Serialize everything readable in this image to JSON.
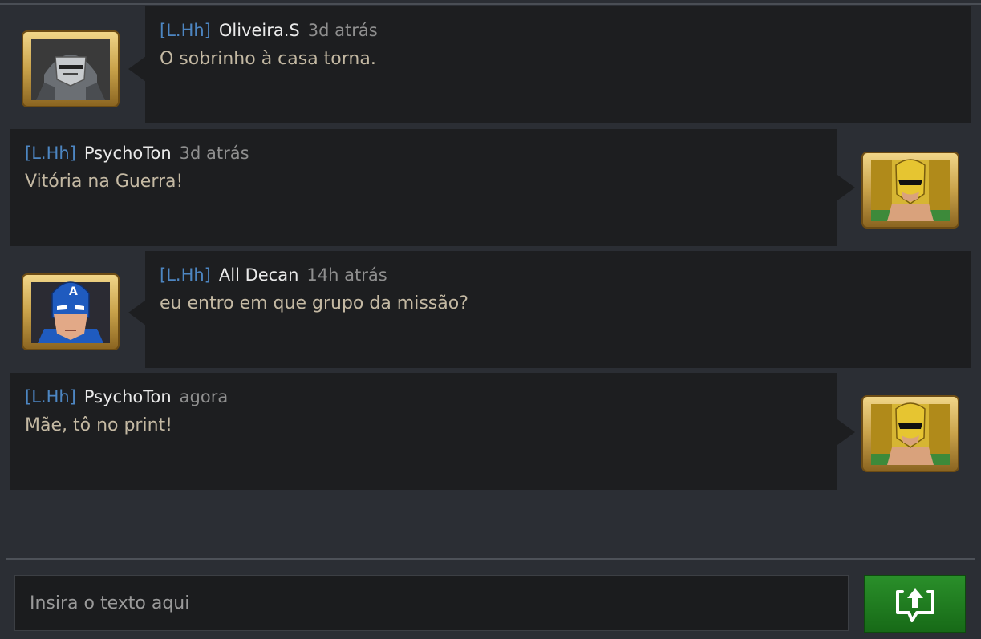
{
  "messages": [
    {
      "tag": "[L.Hh]",
      "name": "Oliveira.S",
      "time": "3d atrás",
      "text": "O sobrinho à casa torna.",
      "avatar_icon": "war-machine-avatar-icon",
      "side": "left"
    },
    {
      "tag": "[L.Hh]",
      "name": "PsychoTon",
      "time": "3d atrás",
      "text": "Vitória na Guerra!",
      "avatar_icon": "iron-fist-avatar-icon",
      "side": "right"
    },
    {
      "tag": "[L.Hh]",
      "name": "All Decan",
      "time": "14h atrás",
      "text": "eu entro em que grupo da missão?",
      "avatar_icon": "captain-america-avatar-icon",
      "side": "left"
    },
    {
      "tag": "[L.Hh]",
      "name": "PsychoTon",
      "time": "agora",
      "text": "Mãe, tô no print!",
      "avatar_icon": "iron-fist-avatar-icon",
      "side": "right"
    }
  ],
  "composer": {
    "placeholder": "Insira o texto aqui",
    "send_icon": "send-message-icon"
  },
  "colors": {
    "background": "#2b2e34",
    "bubble": "#1d1e20",
    "tag": "#4d86c2",
    "name": "#eaeaea",
    "time": "#8f8f8f",
    "text": "#c4b9a3",
    "send": "#1f7d1f",
    "frame_gold": "#c9a24a"
  }
}
